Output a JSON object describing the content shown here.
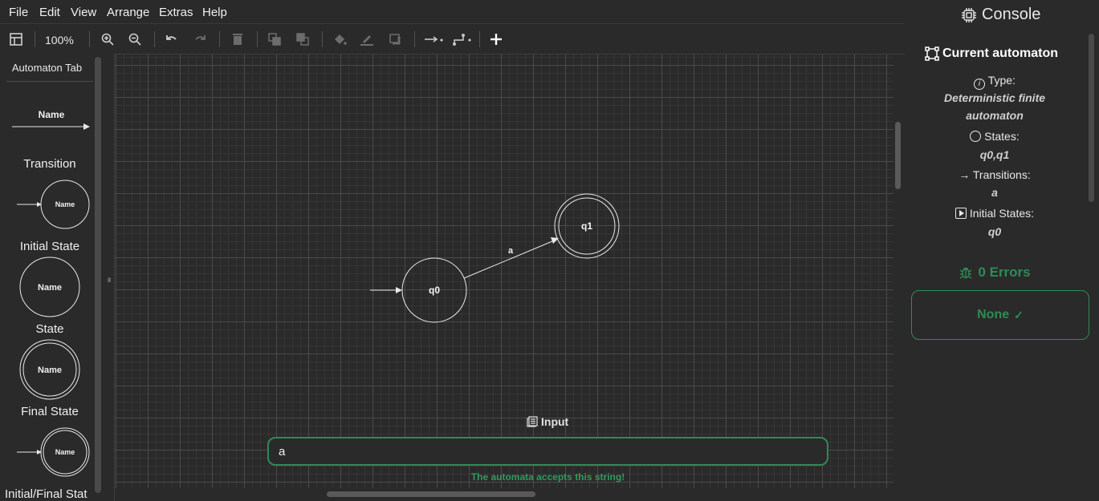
{
  "menu": [
    "File",
    "Edit",
    "View",
    "Arrange",
    "Extras",
    "Help"
  ],
  "toolbar": {
    "zoom": "100%",
    "icons": [
      "format-panel-icon",
      "zoom-in-icon",
      "zoom-out-icon",
      "undo-icon",
      "redo-icon",
      "delete-icon",
      "to-front-icon",
      "to-back-icon",
      "fill-color-icon",
      "line-color-icon",
      "shadow-icon",
      "connection-icon",
      "waypoints-icon",
      "insert-icon"
    ]
  },
  "sidebar": {
    "title": "Automaton Tab",
    "items": [
      {
        "label": "Transition",
        "shape_text": "Name"
      },
      {
        "label": "Initial State",
        "shape_text": "Name"
      },
      {
        "label": "State",
        "shape_text": "Name"
      },
      {
        "label": "Final State",
        "shape_text": "Name"
      },
      {
        "label": "Initial/Final Stat",
        "shape_text": "Name"
      }
    ]
  },
  "diagram": {
    "states": [
      {
        "name": "q0",
        "initial": true,
        "final": false
      },
      {
        "name": "q1",
        "initial": false,
        "final": true
      }
    ],
    "transitions": [
      {
        "from": "q0",
        "to": "q1",
        "label": "a"
      }
    ]
  },
  "input": {
    "title": "Input",
    "value": "a",
    "status": "The automata accepts this string!"
  },
  "console": {
    "title": "Console",
    "automaton_title": "Current automaton",
    "type_label": "Type:",
    "type_value_line1": "Deterministic finite",
    "type_value_line2": "automaton",
    "states_label": "States:",
    "states_value": "q0,q1",
    "transitions_label": "Transitions:",
    "transitions_value": "a",
    "initial_label": "Initial States:",
    "initial_value": "q0",
    "errors": "0 Errors",
    "none_label": "None"
  },
  "colors": {
    "background": "#2a2a2a",
    "accent_green": "#2e8b57",
    "text": "#e8e8e8"
  }
}
